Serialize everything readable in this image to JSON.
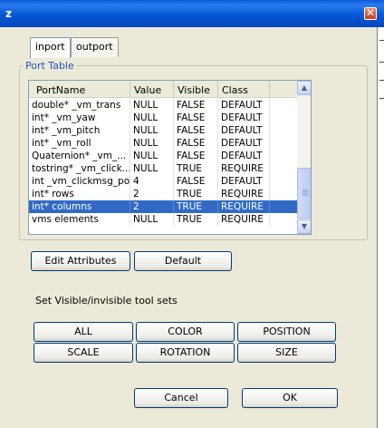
{
  "window": {
    "title": "z",
    "close_symbol": "✕"
  },
  "tabs": [
    {
      "label": "inport",
      "active": true
    },
    {
      "label": "outport",
      "active": false
    }
  ],
  "port_table": {
    "group_label": "Port Table",
    "columns": [
      "PortName",
      "Value",
      "Visible",
      "Class"
    ],
    "rows": [
      [
        "double* _vm_trans",
        "NULL",
        "FALSE",
        "DEFAULT"
      ],
      [
        "int* _vm_yaw",
        "NULL",
        "FALSE",
        "DEFAULT"
      ],
      [
        "int* _vm_pitch",
        "NULL",
        "FALSE",
        "DEFAULT"
      ],
      [
        "int* _vm_roll",
        "NULL",
        "FALSE",
        "DEFAULT"
      ],
      [
        "Quaternion* _vm_...",
        "NULL",
        "FALSE",
        "DEFAULT"
      ],
      [
        "tostring* _vm_click...",
        "NULL",
        "TRUE",
        "REQUIRE"
      ],
      [
        "int _vm_clickmsg_pos",
        "4",
        "FALSE",
        "DEFAULT"
      ],
      [
        "int* rows",
        "2",
        "TRUE",
        "REQUIRE"
      ],
      [
        "int* columns",
        "2",
        "TRUE",
        "REQUIRE"
      ],
      [
        "vms elements",
        "NULL",
        "TRUE",
        "REQUIRE"
      ]
    ],
    "selected_row": 8
  },
  "buttons": {
    "edit_attributes": "Edit Attributes",
    "default": "Default",
    "tool_sets_caption": "Set Visible/invisible tool sets",
    "all": "ALL",
    "color": "COLOR",
    "position": "POSITION",
    "scale": "SCALE",
    "rotation": "ROTATION",
    "size": "SIZE",
    "cancel": "Cancel",
    "ok": "OK"
  },
  "scroll_up_glyph": "▲",
  "scroll_down_glyph": "▼",
  "colors": {
    "titlebar": "#0556d6",
    "selection": "#316ac5",
    "group_label": "#1f54c6"
  }
}
